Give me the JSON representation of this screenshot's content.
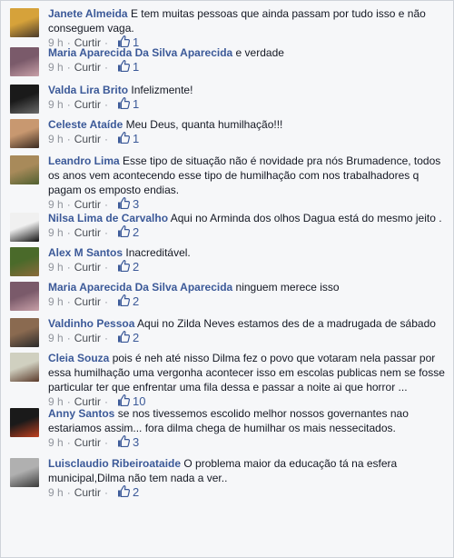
{
  "comments": [
    {
      "author": "Janete Almeida",
      "text": "E tem muitas pessoas que ainda passam por tudo isso e não conseguem vaga.",
      "time": "9 h",
      "action": "Curtir",
      "likes": "1",
      "avatar_colors": [
        "#d6a23a",
        "#4a3a2a"
      ]
    },
    {
      "author": "Maria Aparecida Da Silva Aparecida",
      "text": "e verdade",
      "time": "9 h",
      "action": "Curtir",
      "likes": "1",
      "avatar_colors": [
        "#7a5a6a",
        "#c8a0a8"
      ]
    },
    {
      "author": "Valda Lira Brito",
      "text": "Infelizmente!",
      "time": "9 h",
      "action": "Curtir",
      "likes": "1",
      "avatar_colors": [
        "#1a1a1a",
        "#6a6a6a"
      ]
    },
    {
      "author": "Celeste Ataíde",
      "text": "Meu Deus, quanta humilhação!!!",
      "time": "9 h",
      "action": "Curtir",
      "likes": "1",
      "avatar_colors": [
        "#c89870",
        "#3a2a20"
      ]
    },
    {
      "author": "Leandro Lima",
      "text": "Esse tipo de situação não é novidade pra nós Brumadence, todos os anos vem acontecendo esse tipo de humilhação com nos trabalhadores q pagam os emposto endias.",
      "time": "9 h",
      "action": "Curtir",
      "likes": "3",
      "avatar_colors": [
        "#a88a5a",
        "#506030"
      ]
    },
    {
      "author": "Nilsa Lima de Carvalho",
      "text": "Aqui no Arminda dos olhos Dagua está do mesmo jeito .",
      "time": "9 h",
      "action": "Curtir",
      "likes": "2",
      "avatar_colors": [
        "#f0f0f0",
        "#101010"
      ]
    },
    {
      "author": "Alex M Santos",
      "text": "Inacreditável.",
      "time": "9 h",
      "action": "Curtir",
      "likes": "2",
      "avatar_colors": [
        "#4a6a2a",
        "#8a6a3a"
      ]
    },
    {
      "author": "Maria Aparecida Da Silva Aparecida",
      "text": "ninguem merece isso",
      "time": "9 h",
      "action": "Curtir",
      "likes": "2",
      "avatar_colors": [
        "#7a5a6a",
        "#c8a0a8"
      ]
    },
    {
      "author": "Valdinho Pessoa",
      "text": "Aqui no Zilda Neves estamos des de a madrugada de sábado",
      "time": "9 h",
      "action": "Curtir",
      "likes": "2",
      "avatar_colors": [
        "#8a6a50",
        "#2a2a2a"
      ]
    },
    {
      "author": "Cleia Souza",
      "text": "pois é neh até nisso Dilma fez o povo que votaram nela passar por essa humilhação uma vergonha acontecer isso em escolas publicas nem se fosse particular ter que enfrentar uma fila dessa e passar a noite ai que horror ...",
      "time": "9 h",
      "action": "Curtir",
      "likes": "10",
      "avatar_colors": [
        "#d0d0c0",
        "#5a3a2a"
      ]
    },
    {
      "author": "Anny Santos",
      "text": "se nos tivessemos escolido melhor nossos governantes nao estariamos assim... fora dilma chega de humilhar os mais nessecitados.",
      "time": "9 h",
      "action": "Curtir",
      "likes": "3",
      "avatar_colors": [
        "#1a1a1a",
        "#c04020"
      ]
    },
    {
      "author": "Luisclaudio Ribeiroataide",
      "text": "O problema maior da educação tá na esfera municipal,Dilma não tem nada a ver..",
      "time": "9 h",
      "action": "Curtir",
      "likes": "2",
      "avatar_colors": [
        "#b0b0b0",
        "#3a3a3a"
      ]
    }
  ],
  "colors": {
    "link": "#3b5998",
    "meta": "#90949c",
    "background": "#f6f7f9"
  }
}
